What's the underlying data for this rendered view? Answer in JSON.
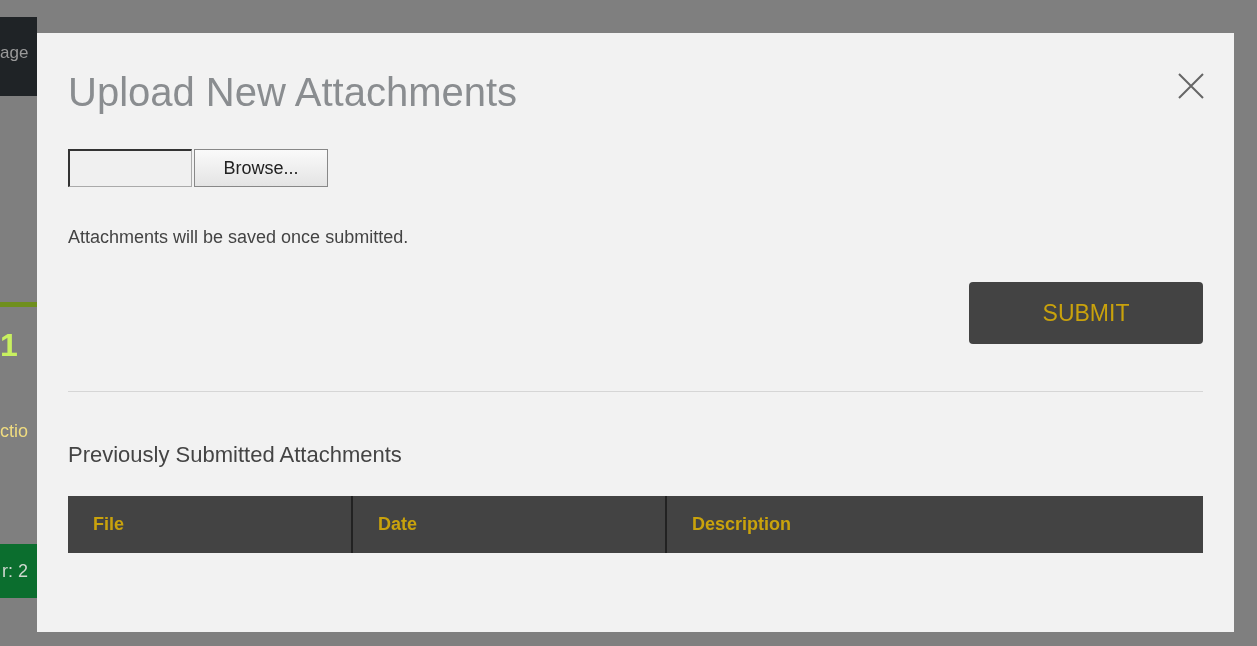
{
  "background": {
    "header_text": "age",
    "heading_text": "1",
    "section_text": "ctio",
    "footer_text": "r: 2"
  },
  "dialog": {
    "title": "Upload New Attachments",
    "file_input": {
      "button": "Browse..."
    },
    "note": "Attachments will be saved once submitted.",
    "submit": "SUBMIT",
    "section_title": "Previously Submitted Attachments",
    "table": {
      "columns": [
        "File",
        "Date",
        "Description"
      ]
    }
  }
}
